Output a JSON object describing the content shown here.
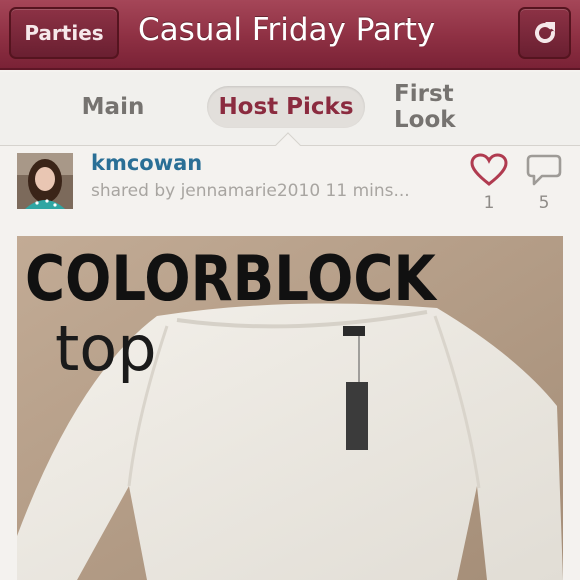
{
  "navbar": {
    "back_label": "Parties",
    "title": "Casual Friday Party",
    "refresh_icon": "refresh-icon"
  },
  "tabs": [
    {
      "label": "Main",
      "active": false
    },
    {
      "label": "Host Picks",
      "active": true
    },
    {
      "label": "First Look",
      "active": false
    }
  ],
  "listing": {
    "username": "kmcowan",
    "shared_by": "shared by jennamarie2010 11 mins...",
    "likes": "1",
    "comments": "5",
    "photo_text": {
      "title": "COLORBLOCK",
      "subtitle": "top"
    }
  },
  "colors": {
    "brand": "#8e3043",
    "link": "#2a6f96",
    "like_icon": "#b03b50"
  }
}
